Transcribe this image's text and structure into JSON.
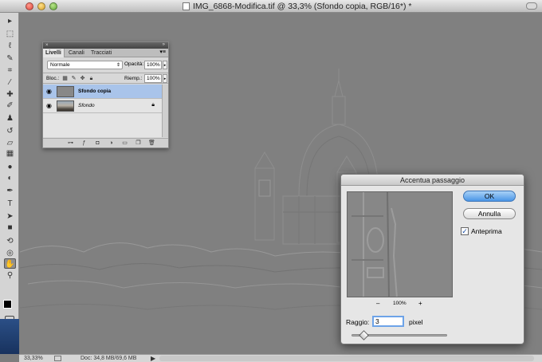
{
  "window": {
    "title": "IMG_6868-Modifica.tif @ 33,3% (Sfondo copia, RGB/16*) *"
  },
  "tools": [
    {
      "icon": "move-tool-icon",
      "glyph": "▸"
    },
    {
      "icon": "marquee-tool-icon",
      "glyph": "⬚"
    },
    {
      "icon": "lasso-tool-icon",
      "glyph": "ℓ"
    },
    {
      "icon": "quick-selection-icon",
      "glyph": "✎"
    },
    {
      "icon": "crop-tool-icon",
      "glyph": "⌗"
    },
    {
      "icon": "eyedropper-icon",
      "glyph": "⁄"
    },
    {
      "icon": "healing-brush-icon",
      "glyph": "✚"
    },
    {
      "icon": "brush-tool-icon",
      "glyph": "✐"
    },
    {
      "icon": "clone-stamp-icon",
      "glyph": "♟"
    },
    {
      "icon": "history-brush-icon",
      "glyph": "↺"
    },
    {
      "icon": "eraser-icon",
      "glyph": "▱"
    },
    {
      "icon": "gradient-tool-icon",
      "glyph": "▦"
    },
    {
      "icon": "blur-tool-icon",
      "glyph": "●"
    },
    {
      "icon": "dodge-tool-icon",
      "glyph": "◐"
    },
    {
      "icon": "pen-tool-icon",
      "glyph": "✒"
    },
    {
      "icon": "type-tool-icon",
      "glyph": "T"
    },
    {
      "icon": "path-selection-icon",
      "glyph": "➤"
    },
    {
      "icon": "shape-tool-icon",
      "glyph": "■"
    },
    {
      "icon": "3d-rotate-icon",
      "glyph": "⟲"
    },
    {
      "icon": "3d-orbit-icon",
      "glyph": "◎"
    },
    {
      "icon": "hand-tool-icon",
      "glyph": "✋"
    },
    {
      "icon": "zoom-tool-icon",
      "glyph": "⚲"
    }
  ],
  "status": {
    "zoom": "33,33%",
    "doc_info": "Doc: 34,8 MB/69,6 MB"
  },
  "layers_panel": {
    "tabs": [
      "Livelli",
      "Canali",
      "Tracciati"
    ],
    "blend_mode": "Normale",
    "opacity_label": "Opacità:",
    "opacity_value": "100%",
    "lock_label": "Bloc.:",
    "fill_label": "Riemp.:",
    "fill_value": "100%",
    "layers": [
      {
        "name": "Sfondo copia",
        "selected": true
      },
      {
        "name": "Sfondo",
        "selected": false
      }
    ]
  },
  "dialog": {
    "title": "Accentua passaggio",
    "ok_label": "OK",
    "cancel_label": "Annulla",
    "preview_label": "Anteprima",
    "preview_checked": true,
    "zoom_minus": "–",
    "zoom_pct": "100%",
    "zoom_plus": "+",
    "radius_label": "Raggio:",
    "radius_value": "3",
    "radius_unit": "pixel"
  },
  "colors": {
    "canvas_bg": "#808080",
    "selected_layer": "#a9c4ea",
    "ok_button": "#4a95e6"
  }
}
